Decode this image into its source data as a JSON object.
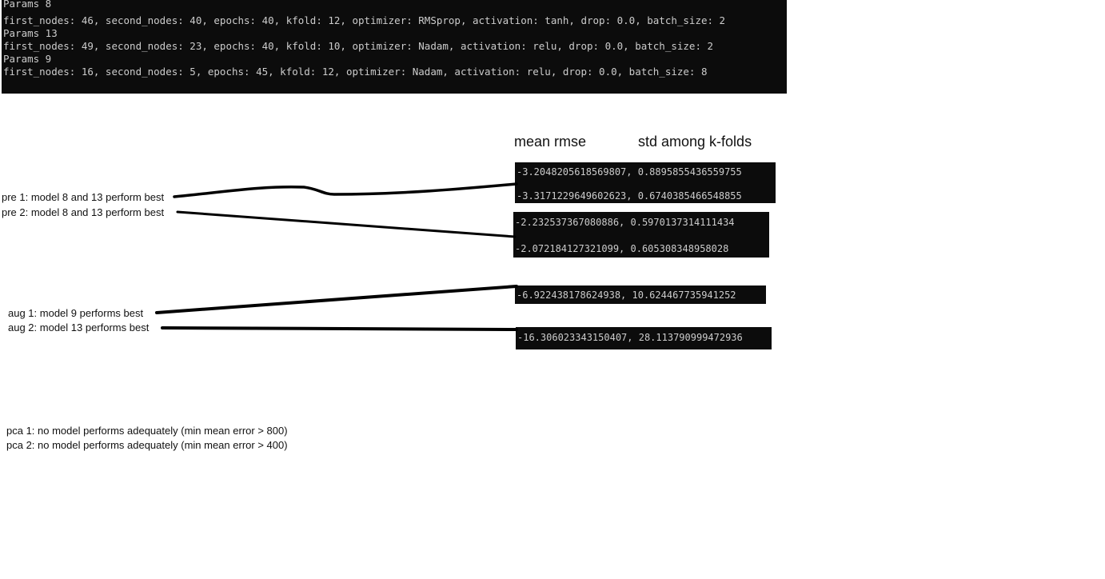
{
  "console": {
    "lines": [
      "Params 8",
      "first_nodes: 46, second_nodes: 40, epochs: 40, kfold: 12, optimizer: RMSprop, activation: tanh, drop: 0.0, batch_size: 2",
      "Params 13",
      "first_nodes: 49, second_nodes: 23, epochs: 40, kfold: 10, optimizer: Nadam, activation: relu, drop: 0.0, batch_size: 2",
      "Params 9",
      "first_nodes: 16, second_nodes: 5, epochs: 45, kfold: 12, optimizer: Nadam, activation: relu, drop: 0.0, batch_size: 8"
    ]
  },
  "headers": {
    "mean_rmse": "mean rmse",
    "std_kfolds": "std among k-folds"
  },
  "notes": {
    "pre1": "pre 1: model 8 and 13 perform best",
    "pre2": "pre 2: model 8 and 13 perform best",
    "aug1": "aug 1: model 9 performs best",
    "aug2": "aug 2: model 13 performs best",
    "pca1": "pca 1: no model performs adequately (min mean error > 800)",
    "pca2": "pca 2: no model performs adequately (min mean error > 400)"
  },
  "results": {
    "pre1": [
      "-3.2048205618569807, 0.8895855436559755",
      "-3.3171229649602623, 0.6740385466548855"
    ],
    "pre2": [
      "-2.232537367080886, 0.5970137314111434",
      "-2.072184127321099, 0.605308348958028"
    ],
    "aug1": "-6.922438178624938, 10.624467735941252",
    "aug2": "-16.306023343150407, 28.113790999472936"
  },
  "colors": {
    "console_bg": "#0c0c0c",
    "console_text": "#cccccc",
    "page_bg": "#ffffff",
    "ink": "#000000"
  }
}
